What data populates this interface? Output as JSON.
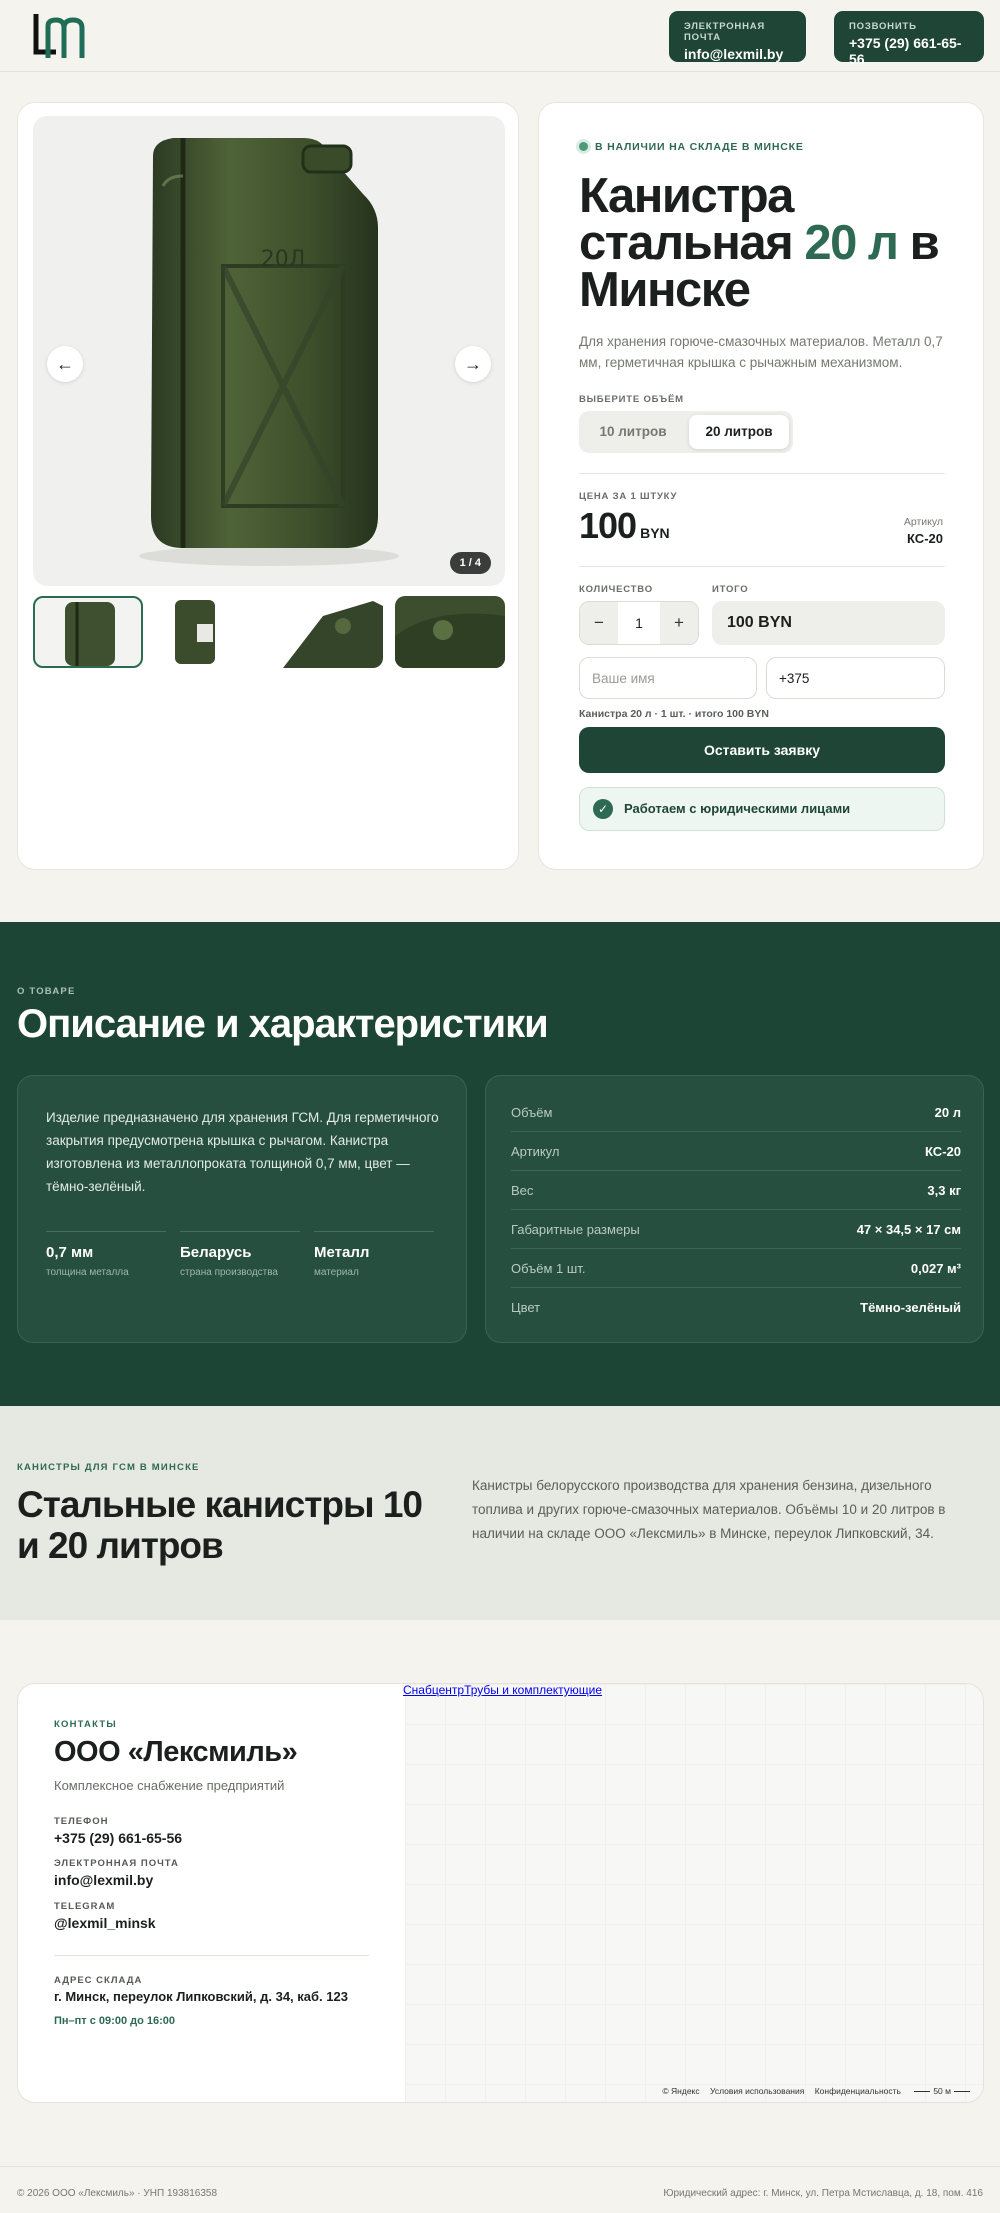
{
  "header": {
    "email_label": "Электронная почта",
    "email": "info@lexmil.by",
    "phone_label": "Позвонить",
    "phone": "+375 (29) 661-65-56"
  },
  "gallery": {
    "prev": "←",
    "next": "→",
    "counter": "1 / 4"
  },
  "product": {
    "stock": "В наличии на складе в Минске",
    "title_part1": "Канистра стальная ",
    "title_accent": "20 л",
    "title_part2": " в Минске",
    "description": "Для хранения горюче-смазочных материалов. Металл 0,7 мм, герметичная крышка с рычажным механизмом.",
    "volume_label": "Выберите объём",
    "volumes": [
      "10 литров",
      "20 литров"
    ],
    "price_label": "Цена за 1 штуку",
    "price": "100",
    "currency": "BYN",
    "article_label": "Артикул",
    "article": "КС-20",
    "qty_label": "Количество",
    "qty_minus": "−",
    "qty_value": "1",
    "qty_plus": "+",
    "total_label": "Итого",
    "total": "100 BYN",
    "name_placeholder": "Ваше имя",
    "phone_value": "+375",
    "summary": "Канистра 20 л · 1 шт. · итого 100 BYN",
    "submit": "Оставить заявку",
    "legal": "Работаем с юридическими лицами",
    "legal_icon": "✓"
  },
  "about": {
    "eyebrow": "О товаре",
    "title": "Описание и характеристики",
    "text": "Изделие предназначено для хранения ГСМ. Для герметичного закрытия предусмотрена крышка с рычагом. Канистра изготовлена из металлопроката толщиной 0,7 мм, цвет — тёмно-зелёный.",
    "features": [
      {
        "value": "0,7 мм",
        "label": "толщина металла"
      },
      {
        "value": "Беларусь",
        "label": "страна производства"
      },
      {
        "value": "Металл",
        "label": "материал"
      }
    ],
    "specs": [
      {
        "key": "Объём",
        "value": "20 л"
      },
      {
        "key": "Артикул",
        "value": "КС-20"
      },
      {
        "key": "Вес",
        "value": "3,3 кг"
      },
      {
        "key": "Габаритные размеры",
        "value": "47 × 34,5 × 17 см"
      },
      {
        "key": "Объём 1 шт.",
        "value": "0,027 м³"
      },
      {
        "key": "Цвет",
        "value": "Тёмно-зелёный"
      }
    ]
  },
  "canisters": {
    "eyebrow": "Канистры для ГСМ в Минске",
    "title": "Стальные канистры 10 и 20 литров",
    "text": "Канистры белорусского производства для хранения бензина, дизельного топлива и других горюче-смазочных материалов. Объёмы 10 и 20 литров в наличии на складе ООО «Лексмиль» в Минске, переулок Липковский, 34."
  },
  "contacts": {
    "eyebrow": "Контакты",
    "company": "ООО «Лексмиль»",
    "subtitle": "Комплексное снабжение предприятий",
    "phone_label": "Телефон",
    "phone": "+375 (29) 661-65-56",
    "email_label": "Электронная почта",
    "email": "info@lexmil.by",
    "telegram_label": "Telegram",
    "telegram": "@lexmil_minsk",
    "address_label": "Адрес склада",
    "address": "г. Минск, переулок Липковский, д. 34, каб. 123",
    "hours": "Пн–пт с 09:00 до 16:00"
  },
  "map": {
    "link1": "Снабцентр",
    "link2": "Трубы и комплектующие",
    "copyright": "© Яндекс",
    "terms": "Условия использования",
    "privacy": "Конфиденциальность",
    "scale": "50 м"
  },
  "footer": {
    "left": "© 2026 ООО «Лексмиль» · УНП 193816358",
    "right": "Юридический адрес: г. Минск, ул. Петра Мстиславца, д. 18, пом. 416"
  },
  "colors": {
    "brand": "#1e4536",
    "accent": "#2e6a53",
    "background": "#f4f3ee"
  }
}
